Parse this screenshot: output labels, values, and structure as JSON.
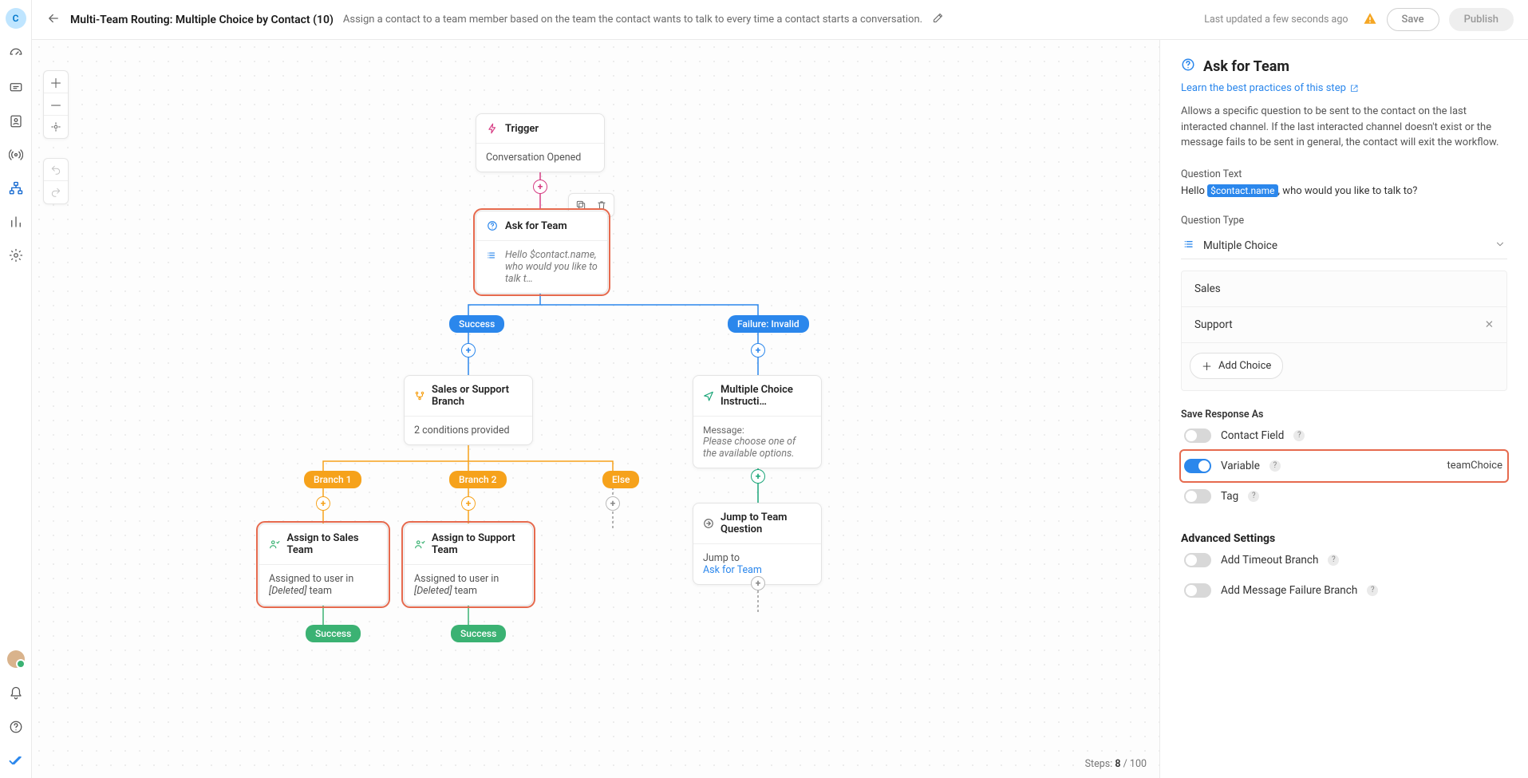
{
  "header": {
    "title": "Multi-Team Routing: Multiple Choice by Contact (10)",
    "description": "Assign a contact to a team member based on the team the contact wants to talk to every time a contact starts a conversation.",
    "last_updated": "Last updated a few seconds ago",
    "save_label": "Save",
    "publish_label": "Publish"
  },
  "rail": {
    "avatar_letter": "C"
  },
  "canvas": {
    "steps_label": "Steps:",
    "steps_current": "8",
    "steps_sep": "/",
    "steps_max": "100",
    "trigger": {
      "title": "Trigger",
      "body": "Conversation Opened"
    },
    "ask": {
      "title": "Ask for Team",
      "body": "Hello $contact.name, who would you like to talk t…"
    },
    "branch_success": "Success",
    "branch_failure": "Failure: Invalid",
    "salesSupport": {
      "title": "Sales or Support Branch",
      "body": "2 conditions provided"
    },
    "mcInstr": {
      "title": "Multiple Choice Instructi…",
      "msg_label": "Message:",
      "msg": "Please choose one of the available options."
    },
    "branch1": "Branch 1",
    "branch2": "Branch 2",
    "branchElse": "Else",
    "assignSales": {
      "title": "Assign to Sales Team",
      "body_prefix": "Assigned to user in ",
      "body_deleted": "[Deleted]",
      "body_suffix": " team"
    },
    "assignSupport": {
      "title": "Assign to Support Team",
      "body_prefix": "Assigned to user in ",
      "body_deleted": "[Deleted]",
      "body_suffix": " team"
    },
    "jump": {
      "title": "Jump to Team Question",
      "label": "Jump to",
      "target": "Ask for Team"
    },
    "success_pill": "Success"
  },
  "panel": {
    "heading": "Ask for Team",
    "learn": "Learn the best practices of this step",
    "description": "Allows a specific question to be sent to the contact on the last interacted channel. If the last interacted channel doesn't exist or the message fails to be sent in general, the contact will exit the workflow.",
    "question_text_label": "Question Text",
    "question_prefix": "Hello ",
    "question_token": "$contact.name",
    "question_suffix": ", who would you like to talk to?",
    "question_type_label": "Question Type",
    "question_type_value": "Multiple Choice",
    "choices": [
      "Sales",
      "Support"
    ],
    "add_choice": "Add Choice",
    "save_response_label": "Save Response As",
    "contact_field": "Contact Field",
    "variable": "Variable",
    "variable_value": "teamChoice",
    "tag": "Tag",
    "advanced": "Advanced Settings",
    "add_timeout": "Add Timeout Branch",
    "add_msg_fail": "Add Message Failure Branch"
  }
}
